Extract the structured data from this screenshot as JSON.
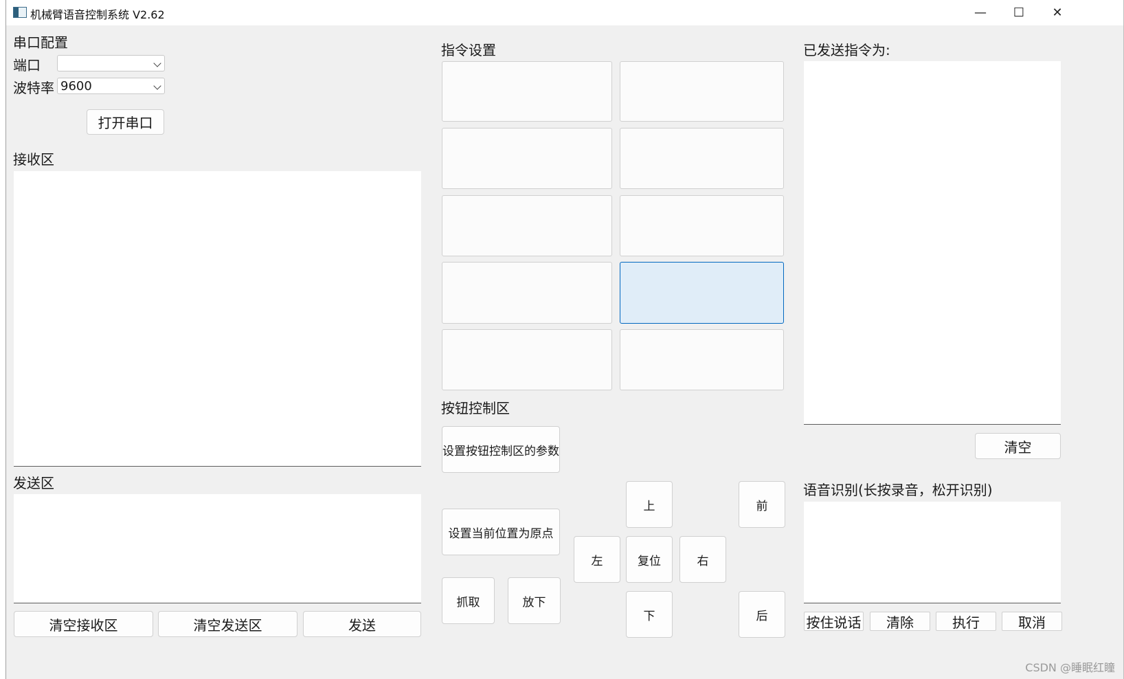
{
  "window": {
    "title": "机械臂语音控制系统 V2.62",
    "controls": {
      "minimize": "—",
      "maximize": "☐",
      "close": "✕"
    }
  },
  "serial": {
    "heading": "串口配置",
    "port_label": "端口",
    "port_value": "",
    "baud_label": "波特率",
    "baud_value": "9600",
    "open_button": "打开串口"
  },
  "receive": {
    "heading": "接收区",
    "content": ""
  },
  "send": {
    "heading": "发送区",
    "content": ""
  },
  "bottom_buttons": {
    "clear_receive": "清空接收区",
    "clear_send": "清空发送区",
    "send": "发送"
  },
  "commands": {
    "heading": "指令设置",
    "buttons": [
      "",
      "",
      "",
      "",
      "",
      "",
      "",
      "",
      "",
      ""
    ],
    "selected_index": 7
  },
  "button_control": {
    "heading": "按钮控制区",
    "set_params": "设置按钮控制区的参数",
    "set_origin": "设置当前位置为原点",
    "grab": "抓取",
    "release": "放下",
    "up": "上",
    "down": "下",
    "left": "左",
    "right": "右",
    "reset": "复位",
    "forward": "前",
    "back": "后"
  },
  "sent": {
    "heading": "已发送指令为:",
    "content": "",
    "clear_button": "清空"
  },
  "voice": {
    "heading": "语音识别(长按录音，松开识别)",
    "content": "",
    "hold_to_talk": "按住说话",
    "clear": "清除",
    "execute": "执行",
    "cancel": "取消"
  },
  "watermark": "CSDN @睡眠红瞳",
  "colors": {
    "window_bg": "#f0f0f0",
    "accent": "#0067c0",
    "selected_bg": "#e0edf8"
  }
}
